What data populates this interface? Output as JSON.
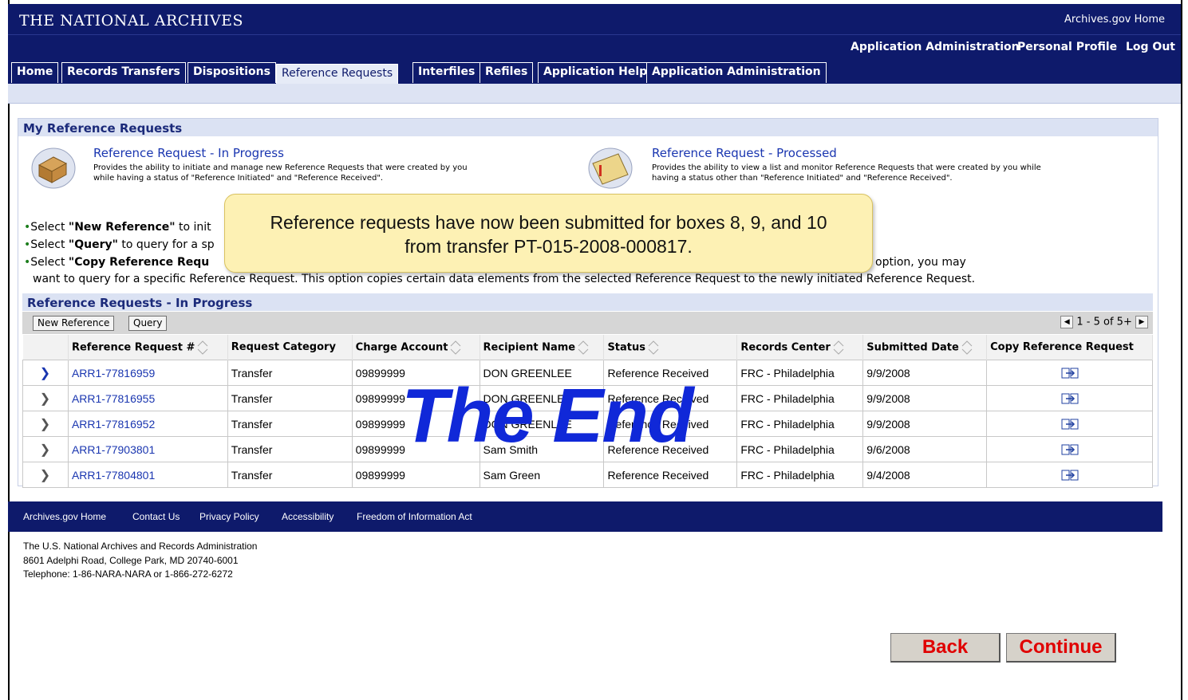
{
  "header": {
    "agency": "THE NATIONAL ARCHIVES",
    "home_link": "Archives.gov Home",
    "util_links": [
      "Application Administration",
      "Personal Profile",
      "Log Out"
    ]
  },
  "nav": {
    "tabs": [
      "Home",
      "Records Transfers",
      "Dispositions",
      "Reference Requests",
      "Interfiles",
      "Refiles",
      "Application Help",
      "Application Administration"
    ],
    "active_tab": "Reference Requests"
  },
  "section": {
    "title": "My Reference Requests",
    "cards": [
      {
        "title": "Reference Request - In Progress",
        "desc_1": "Provides the ability to initiate and manage new Reference Requests that were created by you",
        "desc_2": "while having a status of \"Reference Initiated\" and \"Reference Received\"."
      },
      {
        "title": "Reference Request - Processed",
        "desc_1": "Provides the ability to view a list and monitor Reference Requests that were created by you while",
        "desc_2": "having a status other than \"Reference Initiated\" and \"Reference Received\"."
      }
    ],
    "instructions": {
      "line1_pre": "Select ",
      "line1_bold": "\"New Reference\"",
      "line1_post": " to init",
      "line2_pre": "Select ",
      "line2_bold": "\"Query\"",
      "line2_post": " to query for a sp",
      "line3_pre": "Select ",
      "line3_bold": "\"Copy Reference Requ",
      "line3_tail": "option, you may",
      "line4": "want to query for a specific Reference Request. This option copies certain data elements from the selected Reference Request to the newly initiated Reference Request."
    }
  },
  "grid": {
    "title": "Reference Requests - In Progress",
    "buttons": [
      "New Reference",
      "Query"
    ],
    "pager": "1 - 5 of 5+",
    "columns": [
      "Reference Request #",
      "Request Category",
      "Charge Account",
      "Recipient Name",
      "Status",
      "Records Center",
      "Submitted Date",
      "Copy Reference Request"
    ],
    "rows": [
      {
        "req": "ARR1-77816959",
        "category": "Transfer",
        "account": "09899999",
        "recipient": "DON GREENLEE",
        "status": "Reference Received",
        "center": "FRC - Philadelphia",
        "date": "9/9/2008"
      },
      {
        "req": "ARR1-77816955",
        "category": "Transfer",
        "account": "09899999",
        "recipient": "DON GREENLEE",
        "status": "Reference Received",
        "center": "FRC - Philadelphia",
        "date": "9/9/2008"
      },
      {
        "req": "ARR1-77816952",
        "category": "Transfer",
        "account": "09899999",
        "recipient": "DON GREENLEE",
        "status": "Reference Received",
        "center": "FRC - Philadelphia",
        "date": "9/9/2008"
      },
      {
        "req": "ARR1-77903801",
        "category": "Transfer",
        "account": "09899999",
        "recipient": "Sam Smith",
        "status": "Reference Received",
        "center": "FRC - Philadelphia",
        "date": "9/6/2008"
      },
      {
        "req": "ARR1-77804801",
        "category": "Transfer",
        "account": "09899999",
        "recipient": "Sam Green",
        "status": "Reference Received",
        "center": "FRC - Philadelphia",
        "date": "9/4/2008"
      }
    ]
  },
  "footer": {
    "links": [
      "Archives.gov Home",
      "Contact Us",
      "Privacy Policy",
      "Accessibility",
      "Freedom of Information Act"
    ],
    "address": [
      "The U.S. National Archives and Records Administration",
      "8601 Adelphi Road, College Park, MD 20740-6001",
      "Telephone: 1-86-NARA-NARA or 1-866-272-6272"
    ]
  },
  "callout": {
    "line1": "Reference requests have now been submitted for boxes 8, 9, and 10",
    "line2": "from transfer PT-015-2008-000817."
  },
  "overlay_text": "The End",
  "actions": {
    "back": "Back",
    "continue": "Continue"
  },
  "colors": {
    "nav_bg": "#0e1a6b",
    "header_blue": "#dbe2f3",
    "link": "#1a36b0",
    "end_text": "#1028d8",
    "button_text": "#e00000",
    "callout_bg": "#fdf1b4"
  }
}
